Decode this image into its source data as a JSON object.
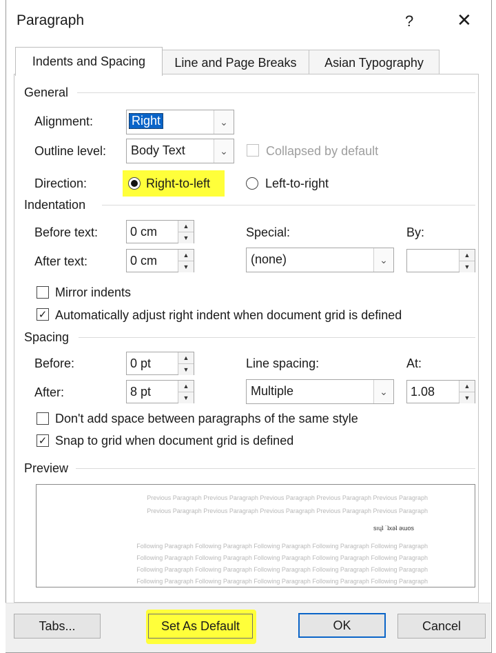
{
  "window": {
    "title": "Paragraph",
    "help_glyph": "?",
    "close_glyph": "✕"
  },
  "tabs": [
    {
      "label": "Indents and Spacing",
      "active": true
    },
    {
      "label": "Line and Page Breaks",
      "active": false
    },
    {
      "label": "Asian Typography",
      "active": false
    }
  ],
  "general": {
    "header": "General",
    "alignment_label": "Alignment:",
    "alignment_value": "Right",
    "outline_label": "Outline level:",
    "outline_value": "Body Text",
    "collapsed_label": "Collapsed by default",
    "collapsed_checked": false,
    "direction_label": "Direction:",
    "rtl_label": "Right-to-left",
    "rtl_selected": true,
    "ltr_label": "Left-to-right",
    "ltr_selected": false
  },
  "indentation": {
    "header": "Indentation",
    "before_label": "Before text:",
    "before_value": "0 cm",
    "after_label": "After text:",
    "after_value": "0 cm",
    "special_label": "Special:",
    "special_value": "(none)",
    "by_label": "By:",
    "by_value": "",
    "mirror_label": "Mirror indents",
    "mirror_checked": false,
    "auto_adjust_label": "Automatically adjust right indent when document grid is defined",
    "auto_adjust_checked": true
  },
  "spacing": {
    "header": "Spacing",
    "before_label": "Before:",
    "before_value": "0 pt",
    "after_label": "After:",
    "after_value": "8 pt",
    "line_spacing_label": "Line spacing:",
    "line_spacing_value": "Multiple",
    "at_label": "At:",
    "at_value": "1.08",
    "dont_add_label": "Don't add space between paragraphs of the same style",
    "dont_add_checked": false,
    "snap_label": "Snap to grid when document grid is defined",
    "snap_checked": true
  },
  "preview": {
    "header": "Preview",
    "prev_line_1": "Previous Paragraph Previous Paragraph Previous Paragraph Previous Paragraph Previous Paragraph",
    "prev_line_2": "Previous Paragraph Previous Paragraph Previous Paragraph Previous Paragraph Previous Paragraph",
    "current_line": "sıɥʇ ˙ʇxǝʇ ǝɯos",
    "follow_line_1": "Following Paragraph Following Paragraph Following Paragraph Following Paragraph Following Paragraph",
    "follow_line_2": "Following Paragraph Following Paragraph Following Paragraph Following Paragraph Following Paragraph",
    "follow_line_3": "Following Paragraph Following Paragraph Following Paragraph Following Paragraph Following Paragraph",
    "follow_line_4": "Following Paragraph Following Paragraph Following Paragraph Following Paragraph Following Paragraph"
  },
  "buttons": {
    "tabs": "Tabs...",
    "set_default": "Set As Default",
    "ok": "OK",
    "cancel": "Cancel"
  },
  "colors": {
    "highlight": "#ffff3a",
    "selection": "#0a64c8",
    "default_button_border": "#0a64c8"
  }
}
